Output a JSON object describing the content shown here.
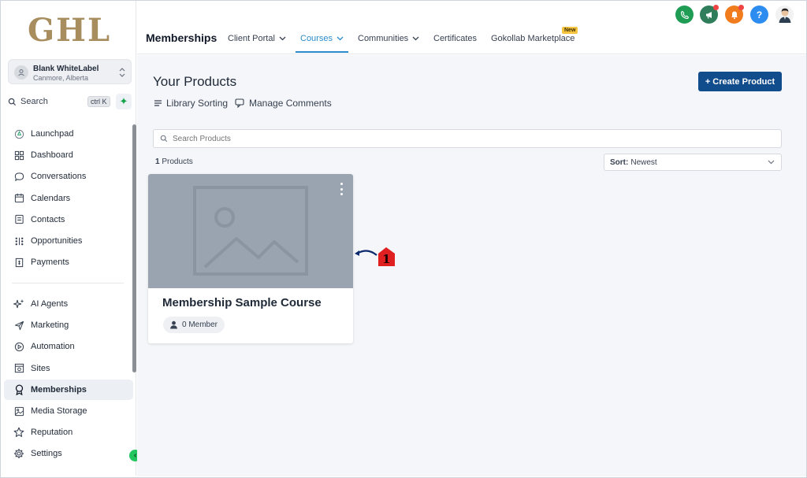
{
  "sidebar": {
    "logo": "GHL",
    "account": {
      "name": "Blank WhiteLabel",
      "location": "Canmore, Alberta"
    },
    "search": {
      "label": "Search",
      "shortcut": "ctrl K"
    },
    "items": [
      {
        "label": "Launchpad",
        "icon": "rocket-icon"
      },
      {
        "label": "Dashboard",
        "icon": "dashboard-icon"
      },
      {
        "label": "Conversations",
        "icon": "chat-icon"
      },
      {
        "label": "Calendars",
        "icon": "calendar-icon"
      },
      {
        "label": "Contacts",
        "icon": "contacts-icon"
      },
      {
        "label": "Opportunities",
        "icon": "opportunities-icon"
      },
      {
        "label": "Payments",
        "icon": "payments-icon"
      }
    ],
    "items2": [
      {
        "label": "AI Agents",
        "icon": "sparkle-icon"
      },
      {
        "label": "Marketing",
        "icon": "send-icon"
      },
      {
        "label": "Automation",
        "icon": "automation-icon"
      },
      {
        "label": "Sites",
        "icon": "sites-icon"
      },
      {
        "label": "Memberships",
        "icon": "award-icon",
        "active": true
      },
      {
        "label": "Media Storage",
        "icon": "image-icon"
      },
      {
        "label": "Reputation",
        "icon": "star-icon"
      },
      {
        "label": "Settings",
        "icon": "gear-icon"
      }
    ]
  },
  "header": {
    "title": "Memberships",
    "tabs": [
      {
        "label": "Client Portal",
        "dropdown": true
      },
      {
        "label": "Courses",
        "dropdown": true,
        "active": true
      },
      {
        "label": "Communities",
        "dropdown": true
      },
      {
        "label": "Certificates",
        "dropdown": false
      },
      {
        "label": "Gokollab Marketplace",
        "dropdown": false,
        "badge": "New"
      }
    ],
    "help_label": "?"
  },
  "main": {
    "heading": "Your Products",
    "library_sorting": "Library Sorting",
    "manage_comments": "Manage Comments",
    "create_button": "+ Create Product",
    "search_placeholder": "Search Products",
    "count_number": "1",
    "count_label": "Products",
    "sort_label": "Sort:",
    "sort_value": "Newest"
  },
  "card": {
    "title": "Membership Sample Course",
    "members": "0 Member"
  },
  "annotation": {
    "number": "1"
  },
  "colors": {
    "accent": "#2a8ccd",
    "primary_button": "#114c8c",
    "phone": "#1f9d55",
    "megaphone": "#2f7d5b",
    "bell": "#f07c1e",
    "help": "#2d8cf0",
    "annotation": "#e02020"
  }
}
